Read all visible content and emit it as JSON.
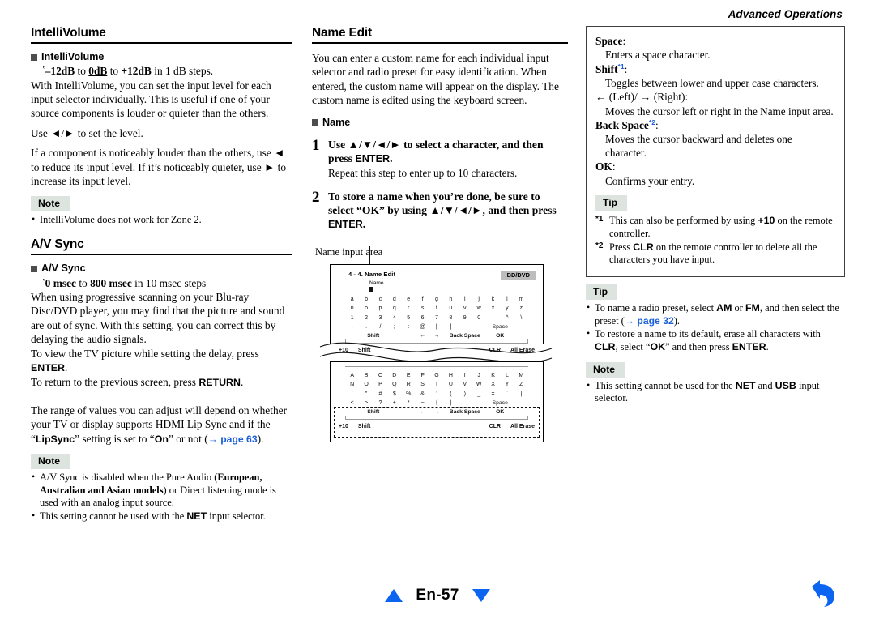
{
  "header": {
    "running_title": "Advanced Operations"
  },
  "footer": {
    "page_label": "En-57",
    "prev_icon": "triangle-up-icon",
    "next_icon": "triangle-down-icon",
    "back_icon": "back-arrow-icon"
  },
  "left_column": {
    "section1": {
      "title": "IntelliVolume",
      "sub_head": "IntelliVolume",
      "range_prefix": "ʽ",
      "range_from": "–12dB",
      "range_to_mid": " to ",
      "range_mid": "0dB",
      "range_to_end": " to ",
      "range_end": "+12dB",
      "range_suffix": " in 1 dB steps.",
      "para1": "With IntelliVolume, you can set the input level for each input selector individually. This is useful if one of your source components is louder or quieter than the others.",
      "para2_pre": "Use ",
      "para2_keys": "◄/►",
      "para2_post": " to set the level.",
      "para3_a": "If a component is noticeably louder than the others, use ",
      "para3_key1": "◄",
      "para3_b": " to reduce its input level. If it’s noticeably quieter, use ",
      "para3_key2": "►",
      "para3_c": " to increase its input level.",
      "note_label": "Note",
      "notes": [
        "IntelliVolume does not work for Zone 2."
      ]
    },
    "section2": {
      "title": "A/V Sync",
      "sub_head": "A/V Sync",
      "range_prefix": "ʽ",
      "range_from": "0 msec",
      "range_to_mid": " to ",
      "range_mid": "800 msec",
      "range_suffix": " in 10 msec steps",
      "para1": "When using progressive scanning on your Blu-ray Disc/DVD player, you may find that the picture and sound are out of sync. With this setting, you can correct this by delaying the audio signals.",
      "para2_a": "To view the TV picture while setting the delay, press ",
      "para2_key": "ENTER",
      "para2_b": ".",
      "para3_a": "To return to the previous screen, press ",
      "para3_key": "RETURN",
      "para3_b": ".",
      "para4_a": "The range of values you can adjust will depend on whether your TV or display supports HDMI Lip Sync and if the “",
      "para4_key1": "LipSync",
      "para4_b": "” setting is set to “",
      "para4_key2": "On",
      "para4_c": "” or not (",
      "para4_link": "→ page 63",
      "para4_d": ").",
      "note_label": "Note",
      "note1_a": "A/V Sync is disabled when the Pure Audio (",
      "note1_bold": "European, Australian and Asian models",
      "note1_b": ") or Direct listening mode is used with an analog input source.",
      "note2_a": "This setting cannot be used with the ",
      "note2_key": "NET",
      "note2_b": " input selector."
    }
  },
  "mid_column": {
    "title": "Name Edit",
    "intro": "You can enter a custom name for each individual input selector and radio preset for easy identification. When entered, the custom name will appear on the display. The custom name is edited using the keyboard screen.",
    "sub_head": "Name",
    "steps": [
      {
        "number": "1",
        "lead_a": "Use ",
        "lead_keys": "▲/▼/◄/►",
        "lead_b": " to select a character, and then press ",
        "lead_key2": "ENTER",
        "lead_c": ".",
        "sub": "Repeat this step to enter up to 10 characters."
      },
      {
        "number": "2",
        "lead_a": "To store a name when you’re done, be sure to select “OK” by using ",
        "lead_keys": "▲/▼/◄/►",
        "lead_b": ", and then press ",
        "lead_key2": "ENTER",
        "lead_c": "."
      }
    ],
    "figure": {
      "caption": "Name input area",
      "screen_title": "4 - 4. Name  Edit",
      "source_badge": "BD/DVD",
      "field_label": "Name",
      "lower_keyboard": {
        "rows": [
          [
            "a",
            "b",
            "c",
            "d",
            "e",
            "f",
            "g",
            "h",
            "i",
            "j",
            "k",
            "l",
            "m"
          ],
          [
            "n",
            "o",
            "p",
            "q",
            "r",
            "s",
            "t",
            "u",
            "v",
            "w",
            "x",
            "y",
            "z"
          ],
          [
            "1",
            "2",
            "3",
            "4",
            "5",
            "6",
            "7",
            "8",
            "9",
            "0",
            "–",
            "^",
            "\\"
          ],
          [
            ",",
            ".",
            "/",
            ";",
            ":",
            "@",
            "[",
            "]"
          ]
        ],
        "space_label": "Space",
        "fn_shift": "Shift",
        "fn_left": "←",
        "fn_right": "→",
        "fn_back": "Back Space",
        "fn_ok": "OK"
      },
      "upper_keyboard": {
        "rows": [
          [
            "A",
            "B",
            "C",
            "D",
            "E",
            "F",
            "G",
            "H",
            "I",
            "J",
            "K",
            "L",
            "M"
          ],
          [
            "N",
            "O",
            "P",
            "Q",
            "R",
            "S",
            "T",
            "U",
            "V",
            "W",
            "X",
            "Y",
            "Z"
          ],
          [
            "!",
            "\"",
            "#",
            "$",
            "%",
            "&",
            "'",
            "(",
            ")",
            "_",
            "=",
            "`",
            "|"
          ],
          [
            "<",
            ">",
            "?",
            "+",
            "*",
            "~",
            "{",
            "}"
          ]
        ],
        "space_label": "Space",
        "fn_shift": "Shift",
        "fn_left": "←",
        "fn_right": "→",
        "fn_back": "Back Space",
        "fn_ok": "OK"
      },
      "hints": {
        "plus10": "+10",
        "shift": "Shift",
        "clr": "CLR",
        "all_erase": "All Erase"
      }
    }
  },
  "right_column": {
    "panel": {
      "space_term": "Space",
      "space_colon": ":",
      "space_def": "Enters a space character.",
      "shift_term": "Shift",
      "shift_fn": "*1",
      "shift_colon": ":",
      "shift_def": "Toggles between lower and upper case characters.",
      "leftright_term": "← (Left)/ → (Right):",
      "leftright_def": "Moves the cursor left or right in the Name input area.",
      "backspace_term": "Back Space",
      "backspace_fn": "*2",
      "backspace_colon": ":",
      "backspace_def": "Moves the cursor backward and deletes one character.",
      "ok_term": "OK",
      "ok_colon": ":",
      "ok_def": "Confirms your entry.",
      "tip_label": "Tip",
      "fn1_mark": "*1",
      "fn1_a": "This can also be performed by using ",
      "fn1_key": "+10",
      "fn1_b": " on the remote controller.",
      "fn2_mark": "*2",
      "fn2_a": "Press ",
      "fn2_key": "CLR",
      "fn2_b": " on the remote controller to delete all the characters you have input."
    },
    "tip_label": "Tip",
    "tip1_a": "To name a radio preset, select ",
    "tip1_key1": "AM",
    "tip1_b": " or ",
    "tip1_key2": "FM",
    "tip1_c": ", and then select the preset (",
    "tip1_link": "→ page 32",
    "tip1_d": ").",
    "tip2_a": "To restore a name to its default, erase all characters with ",
    "tip2_key1": "CLR",
    "tip2_b": ", select “",
    "tip2_key2": "OK",
    "tip2_c": "” and then press ",
    "tip2_key3": "ENTER",
    "tip2_d": ".",
    "note_label": "Note",
    "note1_a": "This setting cannot be used for the ",
    "note1_key1": "NET",
    "note1_b": " and ",
    "note1_key2": "USB",
    "note1_c": " input selector."
  },
  "colors": {
    "link": "#1b5fd9",
    "badge_bg": "#dde4e0",
    "nav_blue": "#0b65f0",
    "source_badge_bg": "#bdbdbd"
  }
}
